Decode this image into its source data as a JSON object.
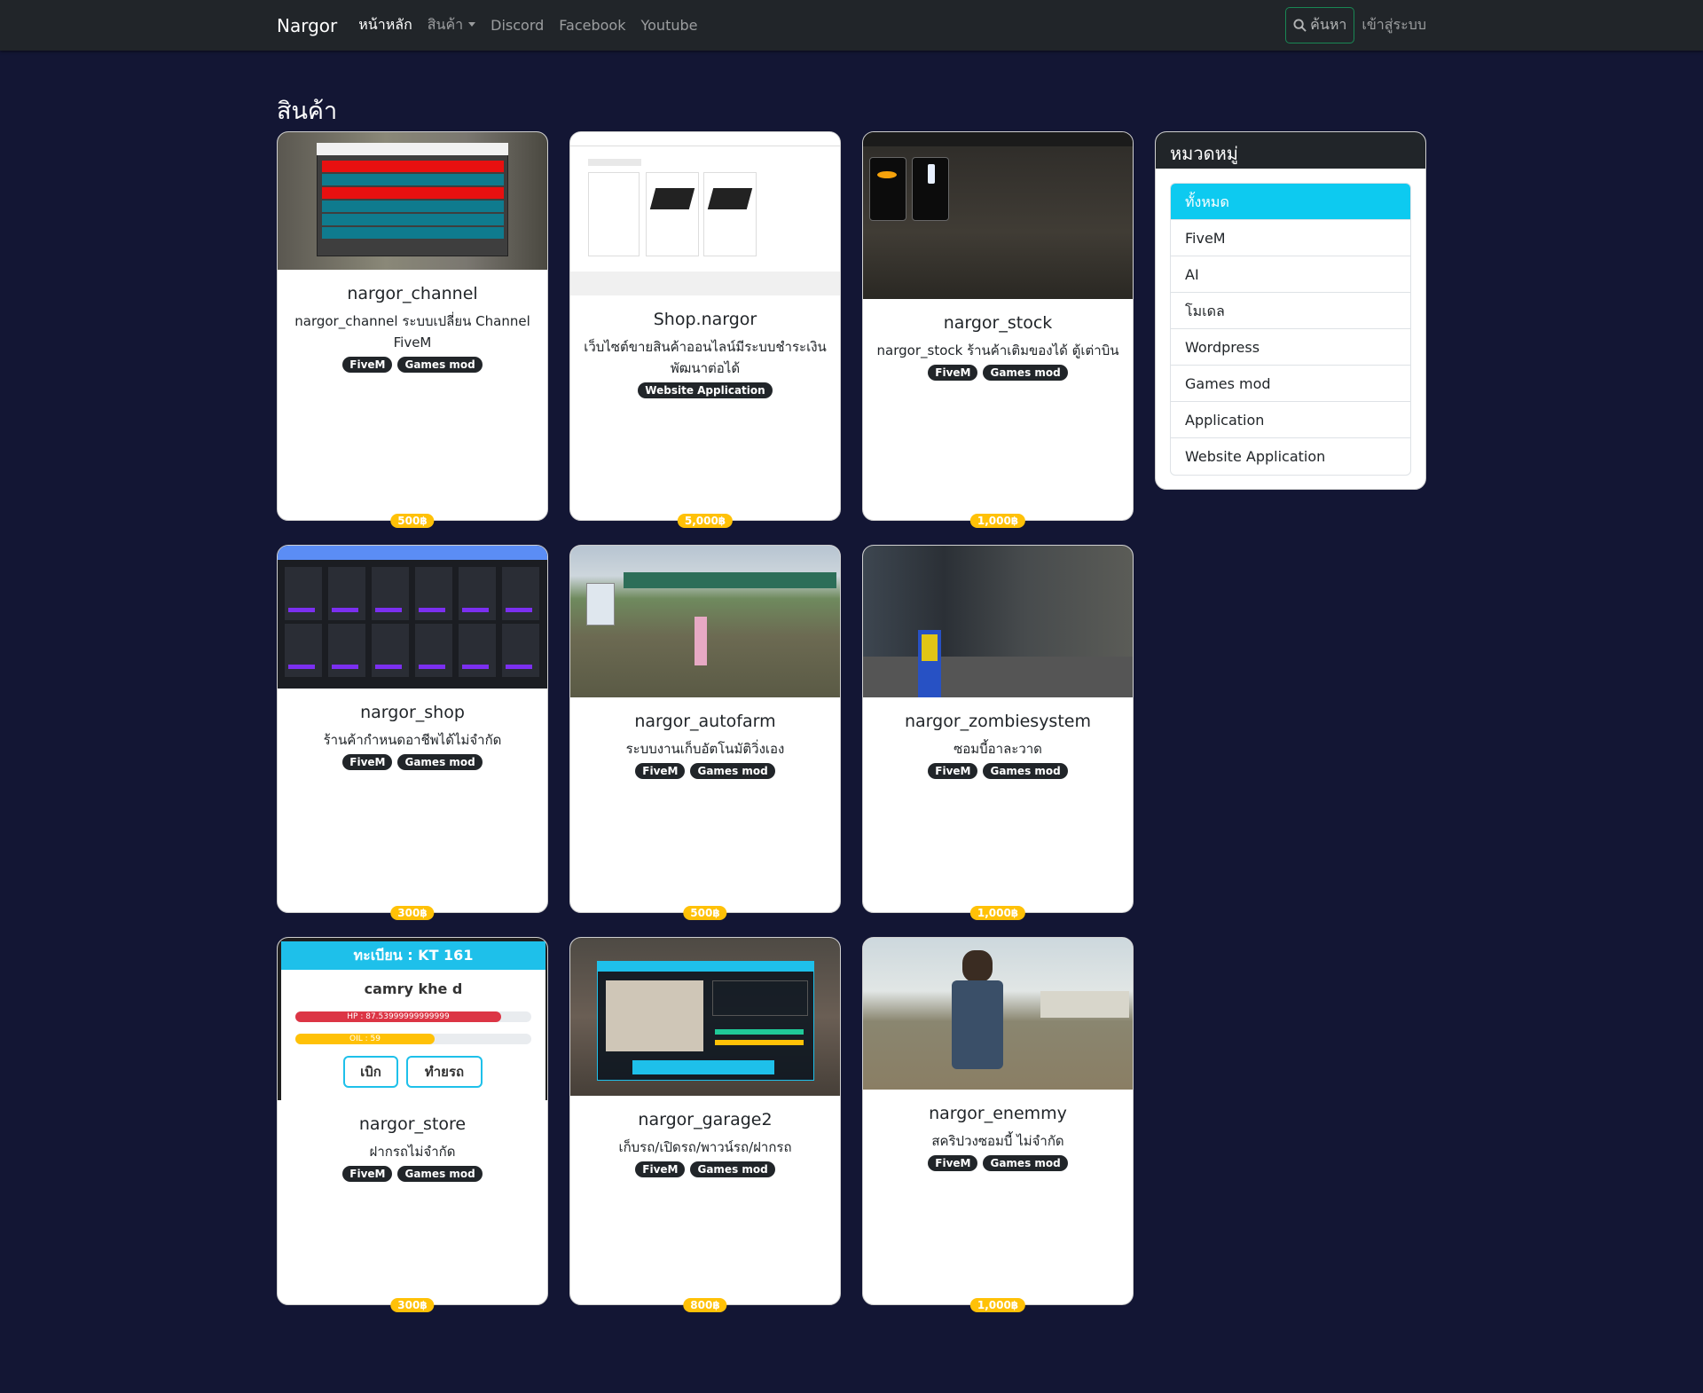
{
  "navbar": {
    "brand": "Nargor",
    "links": [
      "หน้าหลัก",
      "สินค้า",
      "Discord",
      "Facebook",
      "Youtube"
    ],
    "search_label": "ค้นหา",
    "login_label": "เข้าสู่ระบบ"
  },
  "page": {
    "title": "สินค้า"
  },
  "products": [
    {
      "name": "nargor_channel",
      "desc": "nargor_channel ระบบเปลี่ยน Channel FiveM",
      "tags": [
        "FiveM",
        "Games mod"
      ],
      "price": "500฿"
    },
    {
      "name": "Shop.nargor",
      "desc": "เว็บไซต์ขายสินค้าออนไลน์มีระบบชำระเงิน พัฒนาต่อได้",
      "tags": [
        "Website Application"
      ],
      "price": "5,000฿"
    },
    {
      "name": "nargor_stock",
      "desc": "nargor_stock ร้านค้าเติมของได้ ตู้เต่าบิน",
      "tags": [
        "FiveM",
        "Games mod"
      ],
      "price": "1,000฿"
    },
    {
      "name": "nargor_shop",
      "desc": "ร้านค้ากำหนดอาชีพได้ไม่จำกัด",
      "tags": [
        "FiveM",
        "Games mod"
      ],
      "price": "300฿"
    },
    {
      "name": "nargor_autofarm",
      "desc": "ระบบงานเก็บอัตโนมัติวิ่งเอง",
      "tags": [
        "FiveM",
        "Games mod"
      ],
      "price": "500฿"
    },
    {
      "name": "nargor_zombiesystem",
      "desc": "ซอมบี้อาละวาด",
      "tags": [
        "FiveM",
        "Games mod"
      ],
      "price": "1,000฿"
    },
    {
      "name": "nargor_store",
      "desc": "ฝากรถไม่จำกัด",
      "tags": [
        "FiveM",
        "Games mod"
      ],
      "price": "300฿"
    },
    {
      "name": "nargor_garage2",
      "desc": "เก็บรถ/เปิดรถ/พาวน์รถ/ฝากรถ",
      "tags": [
        "FiveM",
        "Games mod"
      ],
      "price": "800฿"
    },
    {
      "name": "nargor_enemmy",
      "desc": "สคริปวงซอมบี้ ไม่จำกัด",
      "tags": [
        "FiveM",
        "Games mod"
      ],
      "price": "1,000฿"
    }
  ],
  "store_preview": {
    "plate": "ทะเบียน : KT 161",
    "car": "camry khe d",
    "hp": "HP : 87.53999999999999",
    "oil": "OIL : 59",
    "btn_withdraw": "เบิก",
    "btn_destroy": "ทำยรถ"
  },
  "sidebar": {
    "title": "หมวดหมู่",
    "categories": [
      "ทั้งหมด",
      "FiveM",
      "AI",
      "โมเดล",
      "Wordpress",
      "Games mod",
      "Application",
      "Website Application"
    ],
    "active_index": 0
  },
  "colors": {
    "bg": "#131634",
    "navbar": "#212529",
    "accent_active": "#0dcaf0",
    "price_badge": "#ffc107",
    "search_border": "#198754"
  }
}
